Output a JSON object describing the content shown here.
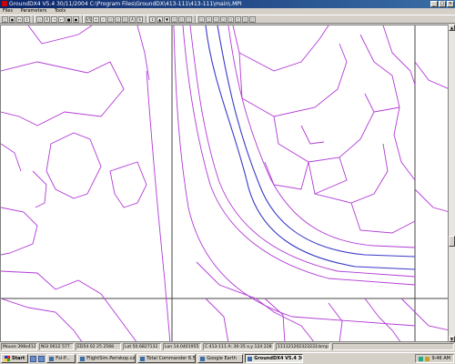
{
  "window": {
    "title": "GroundDX4 V5.4 30/11/2004  C:\\Program Files\\GroundDX\\413-111\\413-111\\main\\.MPI"
  },
  "menu": [
    "Files",
    "Parameters",
    "Tools"
  ],
  "toolbar": {
    "buttons": [
      "□",
      "▣",
      "↔",
      "↕",
      "○",
      "A",
      "→",
      "←",
      "■",
      "●",
      "V5",
      "+",
      "✓",
      "□",
      "□",
      "□",
      "A",
      "S",
      "↕",
      "▲",
      "▼",
      "□",
      "□",
      "□",
      "□",
      "□",
      "□",
      "□",
      "□",
      "□",
      "□",
      "□"
    ]
  },
  "map": {
    "line_color": "#b23ad6",
    "road_color": "#3a3ac8",
    "grid_color": "#444444"
  },
  "status": {
    "mouse": "Mouse 398x4121",
    "ngi": "NGI 0612 577",
    "ed": "ED54 02 25 2568",
    "lat": "Lat 50.6827132",
    "lon": "Lon 14.0401955",
    "c": "C 413-111  A: 30-35  x,y 124 228",
    "file": "111121202323233.bmp"
  },
  "taskbar": {
    "start": "Start",
    "tasks": [
      {
        "label": "Fsl-P...",
        "active": false
      },
      {
        "label": "FlightSim.Periskop.cz - Mi...",
        "active": false
      },
      {
        "label": "Total Commander 6.52 -...",
        "active": false
      },
      {
        "label": "Google Earth",
        "active": false
      },
      {
        "label": "GroundDX4 V5.4 30/1...",
        "active": true
      }
    ],
    "clock": "9:46 AM"
  }
}
